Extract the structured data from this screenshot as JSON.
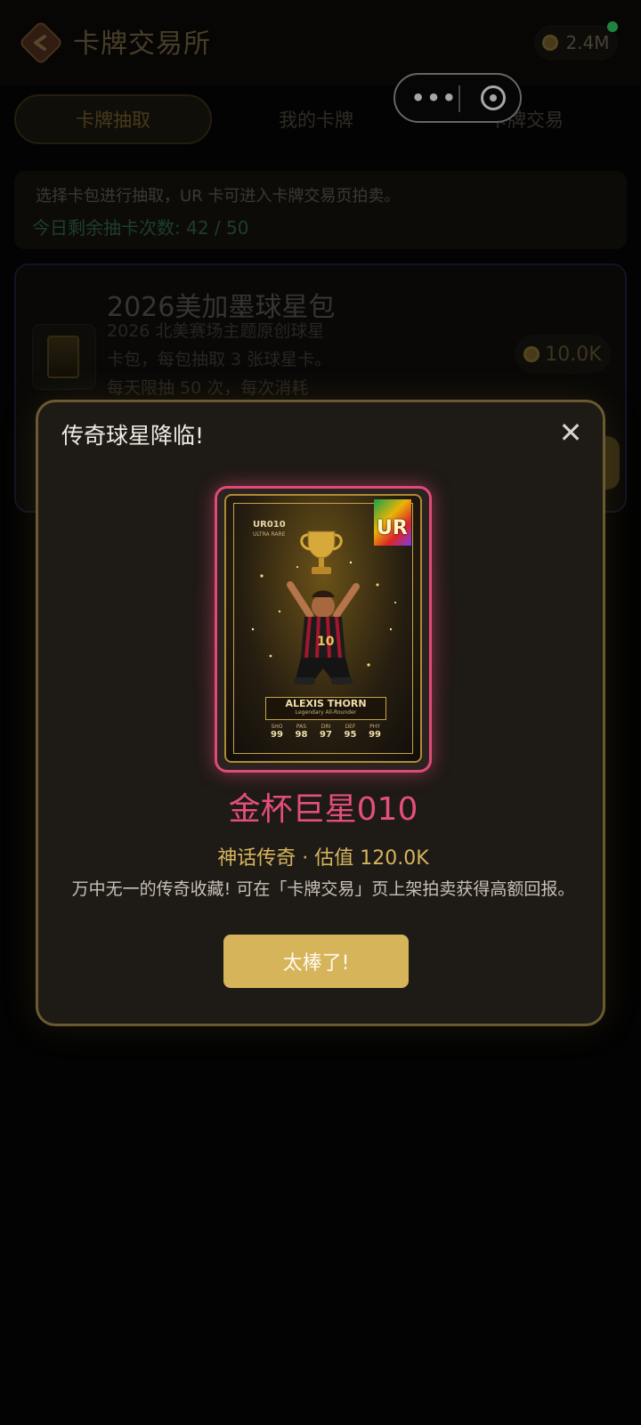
{
  "header": {
    "title": "卡牌交易所",
    "coins": "2.4M",
    "back_icon": "back-arrow-icon"
  },
  "tabs": [
    {
      "label": "卡牌抽取",
      "active": true
    },
    {
      "label": "我的卡牌",
      "active": false
    },
    {
      "label": "卡牌交易",
      "active": false
    }
  ],
  "capsule": {
    "more_glyph": "•••"
  },
  "info": {
    "line1": "选择卡包进行抽取，UR 卡可进入卡牌交易页拍卖。",
    "remaining_label": "今日剩余抽卡次数:",
    "remaining_value": "42 / 50"
  },
  "pack": {
    "title": "2026美加墨球星包",
    "desc": "2026 北美赛场主题原创球星卡包，每包抽取 3 张球星卡。每天限抽 50 次，每次消耗",
    "price": "10.0K"
  },
  "modal": {
    "title": "传奇球星降临!",
    "card": {
      "code": "UR010",
      "code_sub": "ULTRA RARE",
      "badge": "UR",
      "player_name": "ALEXIS THORN",
      "player_sub": "Legendary All-Rounder",
      "stats": [
        {
          "k": "SHO",
          "v": "99"
        },
        {
          "k": "PAS",
          "v": "98"
        },
        {
          "k": "DRI",
          "v": "97"
        },
        {
          "k": "DEF",
          "v": "95"
        },
        {
          "k": "PHY",
          "v": "99"
        }
      ]
    },
    "card_name": "金杯巨星010",
    "rarity_line": "神话传奇 · 估值 120.0K",
    "description": "万中无一的传奇收藏! 可在「卡牌交易」页上架拍卖获得高额回报。",
    "confirm_label": "太棒了!"
  },
  "colors": {
    "accent_gold": "#d6b45a",
    "card_name_pink": "#e44f77",
    "online_dot": "#2ecc62"
  }
}
